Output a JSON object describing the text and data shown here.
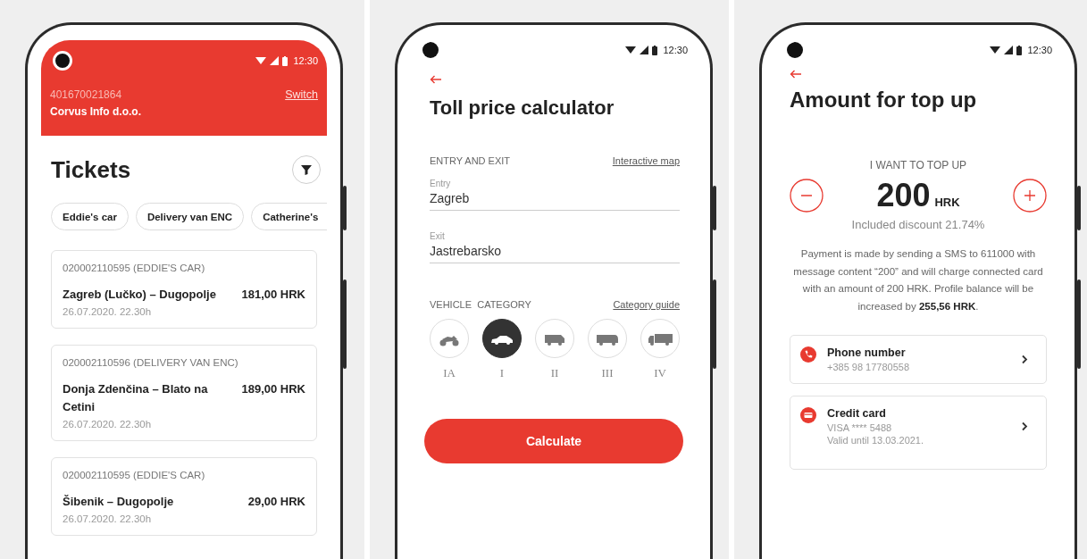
{
  "screens": [
    {
      "kind": "tickets",
      "status": {
        "time": "12:30"
      },
      "header": {
        "account": "401670021864",
        "switch_link": "Switch",
        "company": "Corvus Info d.o.o."
      },
      "title": "Tickets",
      "chips": [
        {
          "label": "Eddie's car"
        },
        {
          "label": "Delivery van ENC"
        },
        {
          "label": "Catherine's"
        }
      ],
      "tickets": [
        {
          "id": "020002110595 (EDDIE'S CAR)",
          "route": "Zagreb (Lučko) – Dugopolje",
          "price": "181,00 HRK",
          "date": "26.07.2020. 22.30h"
        },
        {
          "id": "020002110596 (DELIVERY VAN ENC)",
          "route": "Donja Zdenčina – Blato na Cetini",
          "price": "189,00 HRK",
          "date": "26.07.2020. 22.30h"
        },
        {
          "id": "020002110595 (EDDIE'S CAR)",
          "route": "Šibenik – Dugopolje",
          "price": "29,00 HRK",
          "date": "26.07.2020. 22.30h"
        }
      ]
    },
    {
      "kind": "calculator",
      "status": {
        "time": "12:30"
      },
      "title": "Toll price calculator",
      "section_label": "ENTRY AND EXIT",
      "map_link": "Interactive map",
      "fields": [
        {
          "label": "Entry",
          "value": "Zagreb"
        },
        {
          "label": "Exit",
          "value": "Jastrebarsko"
        }
      ],
      "category_label": "VEHICLE  CATEGORY",
      "guide_link": "Category guide",
      "categories": [
        {
          "label": "IA",
          "kind": "motorcycle",
          "selected": false
        },
        {
          "label": "I",
          "kind": "car",
          "selected": true
        },
        {
          "label": "II",
          "kind": "van",
          "selected": false
        },
        {
          "label": "III",
          "kind": "bus",
          "selected": false
        },
        {
          "label": "IV",
          "kind": "truck",
          "selected": false
        }
      ],
      "button": "Calculate"
    },
    {
      "kind": "topup",
      "status": {
        "time": "12:30"
      },
      "title": "Amount for top up",
      "amount_label": "I WANT TO TOP UP",
      "amount": "200",
      "currency": "HRK",
      "discount": "Included discount 21.74%",
      "note": "Payment is made by sending a SMS to 611000 with message content “200” and will charge connected card with an amount of 200 HRK. Profile balance will be increased by **255,56 HRK**.",
      "methods": [
        {
          "kind": "phone",
          "title": "Phone number",
          "lines": [
            "+385 98 17780558"
          ]
        },
        {
          "kind": "card",
          "title": "Credit card",
          "lines": [
            "VISA **** 5488",
            "Valid until 13.03.2021."
          ]
        }
      ]
    }
  ]
}
